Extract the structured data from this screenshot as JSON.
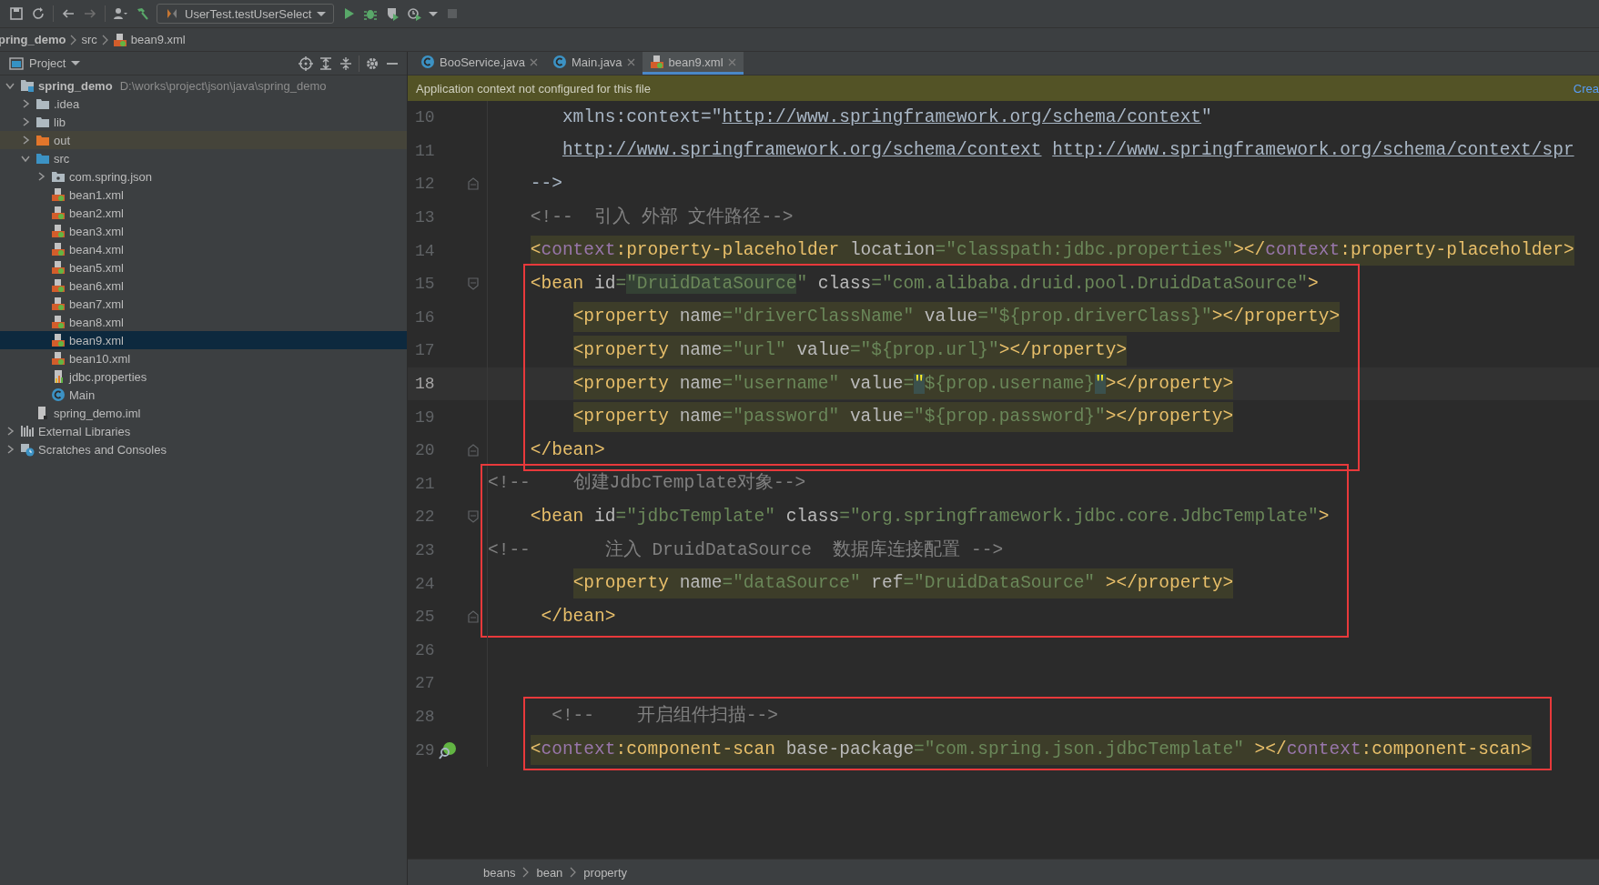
{
  "toolbar": {
    "run_config": "UserTest.testUserSelect"
  },
  "navigation_bar": {
    "items": [
      {
        "label": "pring_demo",
        "kind": "module"
      },
      {
        "label": "src",
        "kind": "folder"
      },
      {
        "label": "bean9.xml",
        "kind": "xml"
      }
    ]
  },
  "project_panel": {
    "title": "Project",
    "tree": [
      {
        "label": "spring_demo",
        "path": "D:\\works\\project\\json\\java\\spring_demo",
        "kind": "project",
        "expanded": true,
        "selected": false,
        "children": [
          {
            "label": ".idea",
            "kind": "folder",
            "expanded": false,
            "selected": false
          },
          {
            "label": "lib",
            "kind": "folder",
            "expanded": false,
            "selected": false
          },
          {
            "label": "out",
            "kind": "excluded-folder",
            "expanded": false,
            "selected": false
          },
          {
            "label": "src",
            "kind": "source-folder",
            "expanded": true,
            "selected": false,
            "children": [
              {
                "label": "com.spring.json",
                "kind": "package",
                "expanded": false,
                "selected": false
              },
              {
                "label": "bean1.xml",
                "kind": "xml",
                "selected": false
              },
              {
                "label": "bean2.xml",
                "kind": "xml",
                "selected": false
              },
              {
                "label": "bean3.xml",
                "kind": "xml",
                "selected": false
              },
              {
                "label": "bean4.xml",
                "kind": "xml",
                "selected": false
              },
              {
                "label": "bean5.xml",
                "kind": "xml",
                "selected": false
              },
              {
                "label": "bean6.xml",
                "kind": "xml",
                "selected": false
              },
              {
                "label": "bean7.xml",
                "kind": "xml",
                "selected": false
              },
              {
                "label": "bean8.xml",
                "kind": "xml",
                "selected": false
              },
              {
                "label": "bean9.xml",
                "kind": "xml",
                "selected": true
              },
              {
                "label": "bean10.xml",
                "kind": "xml",
                "selected": false
              },
              {
                "label": "jdbc.properties",
                "kind": "properties",
                "selected": false
              },
              {
                "label": "Main",
                "kind": "class",
                "selected": false
              }
            ]
          },
          {
            "label": "spring_demo.iml",
            "kind": "iml",
            "selected": false
          }
        ]
      },
      {
        "label": "External Libraries",
        "kind": "libraries",
        "expanded": false,
        "selected": false
      },
      {
        "label": "Scratches and Consoles",
        "kind": "scratches",
        "expanded": false,
        "selected": false
      }
    ]
  },
  "tabs": [
    {
      "label": "BooService.java",
      "kind": "class",
      "selected": false
    },
    {
      "label": "Main.java",
      "kind": "class",
      "selected": false
    },
    {
      "label": "bean9.xml",
      "kind": "xml",
      "selected": true
    }
  ],
  "notification": {
    "text": "Application context not configured for this file",
    "link": "Crea"
  },
  "editor": {
    "blocks": [
      {
        "lines": [
          {
            "number": "10",
            "tokens": [
              {
                "kind": "p",
                "text": "       xmlns:context=\""
              },
              {
                "kind": "u",
                "text": "http://www.springframework.org/schema/context"
              },
              {
                "kind": "p",
                "text": "\""
              }
            ]
          },
          {
            "number": "11",
            "tokens": [
              {
                "kind": "u",
                "text": "       http://www.springframework.org/schema/context"
              },
              {
                "kind": "u",
                "text": " http://www.springframework.org/schema/context/spr"
              }
            ]
          },
          {
            "number": "12",
            "fold_end": true,
            "tokens": [
              {
                "kind": "p",
                "text": "    -->"
              }
            ]
          },
          {
            "number": "13",
            "tokens": [
              {
                "kind": "c",
                "text": "    <!--  引入 外部 文件路径-->"
              }
            ]
          },
          {
            "number": "14",
            "highlighted": true,
            "tokens": [
              {
                "kind": "t",
                "text": "    <"
              },
              {
                "kind": "n",
                "text": "context"
              },
              {
                "kind": "t",
                "text": ":property-placeholder"
              },
              {
                "kind": "a",
                "text": " location"
              },
              {
                "kind": "v",
                "text": "=\"classpath:jdbc.properties\""
              },
              {
                "kind": "t",
                "text": "></"
              },
              {
                "kind": "n",
                "text": "context"
              },
              {
                "kind": "t",
                "text": ":property-placeholder>"
              }
            ]
          }
        ]
      },
      {
        "boxed": true,
        "lines": [
          {
            "number": "15",
            "fold_start": true,
            "tokens": [
              {
                "kind": "t",
                "text": "    <bean"
              },
              {
                "kind": "a",
                "text": " id"
              },
              {
                "kind": "v",
                "text": "="
              },
              {
                "kind": "m",
                "text": "\"DruidDataSource"
              },
              {
                "kind": "v",
                "text": "\""
              },
              {
                "kind": "a",
                "text": " class"
              },
              {
                "kind": "v",
                "text": "=\"com.alibaba.druid.pool.DruidDataSource\""
              },
              {
                "kind": "t",
                "text": ">"
              }
            ]
          },
          {
            "number": "16",
            "highlighted": true,
            "tokens": [
              {
                "kind": "t",
                "text": "        <property"
              },
              {
                "kind": "a",
                "text": " name"
              },
              {
                "kind": "v",
                "text": "=\"driverClassName\""
              },
              {
                "kind": "a",
                "text": " value"
              },
              {
                "kind": "v",
                "text": "=\"${prop.driverClass}\""
              },
              {
                "kind": "t",
                "text": "></property>"
              }
            ]
          },
          {
            "number": "17",
            "highlighted": true,
            "tokens": [
              {
                "kind": "t",
                "text": "        <property"
              },
              {
                "kind": "a",
                "text": " name"
              },
              {
                "kind": "v",
                "text": "=\"url\""
              },
              {
                "kind": "a",
                "text": " value"
              },
              {
                "kind": "v",
                "text": "=\"${prop.url}\""
              },
              {
                "kind": "t",
                "text": "></property>"
              }
            ]
          },
          {
            "number": "18",
            "highlighted": true,
            "current": true,
            "tokens": [
              {
                "kind": "t",
                "text": "        <property"
              },
              {
                "kind": "a",
                "text": " name"
              },
              {
                "kind": "v",
                "text": "=\"username\""
              },
              {
                "kind": "a",
                "text": " value"
              },
              {
                "kind": "v",
                "text": "="
              },
              {
                "kind": "q",
                "text": "\""
              },
              {
                "kind": "v",
                "text": "${prop.username}"
              },
              {
                "kind": "q",
                "text": "\""
              },
              {
                "kind": "t",
                "text": "></property>"
              }
            ]
          },
          {
            "number": "19",
            "highlighted": true,
            "tokens": [
              {
                "kind": "t",
                "text": "        <property"
              },
              {
                "kind": "a",
                "text": " name"
              },
              {
                "kind": "v",
                "text": "=\"password\""
              },
              {
                "kind": "a",
                "text": " value"
              },
              {
                "kind": "v",
                "text": "=\"${prop.password}\""
              },
              {
                "kind": "t",
                "text": "></property>"
              }
            ]
          },
          {
            "number": "20",
            "fold_end": true,
            "tokens": [
              {
                "kind": "t",
                "text": "    </bean>"
              }
            ]
          }
        ]
      },
      {
        "boxed": true,
        "lines": [
          {
            "number": "21",
            "tokens": [
              {
                "kind": "c",
                "text": "<!--    创建JdbcTemplate对象-->"
              }
            ]
          },
          {
            "number": "22",
            "fold_start": true,
            "tokens": [
              {
                "kind": "t",
                "text": "    <bean"
              },
              {
                "kind": "a",
                "text": " id"
              },
              {
                "kind": "v",
                "text": "=\"jdbcTemplate\""
              },
              {
                "kind": "a",
                "text": " class"
              },
              {
                "kind": "v",
                "text": "=\"org.springframework.jdbc.core.JdbcTemplate\""
              },
              {
                "kind": "t",
                "text": ">"
              }
            ]
          },
          {
            "number": "23",
            "tokens": [
              {
                "kind": "c",
                "text": "<!--       注入 DruidDataSource  数据库连接配置 -->"
              }
            ]
          },
          {
            "number": "24",
            "highlighted": true,
            "tokens": [
              {
                "kind": "t",
                "text": "        <property"
              },
              {
                "kind": "a",
                "text": " name"
              },
              {
                "kind": "v",
                "text": "=\"dataSource\""
              },
              {
                "kind": "a",
                "text": " ref"
              },
              {
                "kind": "v",
                "text": "=\"DruidDataSource\""
              },
              {
                "kind": "t",
                "text": " ></property>"
              }
            ]
          },
          {
            "number": "25",
            "fold_end": true,
            "tokens": [
              {
                "kind": "t",
                "text": "     </bean>"
              }
            ]
          }
        ]
      },
      {
        "lines": [
          {
            "number": "26"
          },
          {
            "number": "27"
          }
        ]
      },
      {
        "boxed": true,
        "lines": [
          {
            "number": "28",
            "tokens": [
              {
                "kind": "c",
                "text": "      <!--    开启组件扫描-->"
              }
            ]
          },
          {
            "number": "29",
            "highlighted": true,
            "bean_marker": true,
            "tokens": [
              {
                "kind": "t",
                "text": "    <"
              },
              {
                "kind": "n",
                "text": "context"
              },
              {
                "kind": "t",
                "text": ":component-scan"
              },
              {
                "kind": "a",
                "text": " base-package"
              },
              {
                "kind": "v",
                "text": "=\"com.spring.json.jdbcTemplate\""
              },
              {
                "kind": "t",
                "text": " ></"
              },
              {
                "kind": "n",
                "text": "context"
              },
              {
                "kind": "t",
                "text": ":component-scan>"
              }
            ]
          }
        ]
      }
    ]
  },
  "status_breadcrumb": [
    "beans",
    "bean",
    "property"
  ]
}
